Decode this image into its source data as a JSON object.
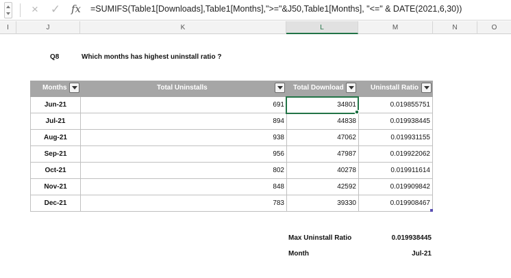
{
  "formula_bar": {
    "cancel_icon": "×",
    "confirm_icon": "✓",
    "fx_label": "fx",
    "formula": "=SUMIFS(Table1[Downloads],Table1[Months],\">=\"&J50,Table1[Months], \"<=\" & DATE(2021,6,30))"
  },
  "columns": [
    "I",
    "J",
    "K",
    "L",
    "M",
    "N",
    "O"
  ],
  "active_column": "L",
  "question": {
    "id": "Q8",
    "text": "Which months has highest uninstall ratio ?"
  },
  "table": {
    "headers": [
      "Months",
      "Total Uninstalls",
      "Total Download",
      "Uninstall Ratio"
    ],
    "rows": [
      {
        "month": "Jun-21",
        "uninstalls": "691",
        "downloads": "34801",
        "ratio": "0.019855751"
      },
      {
        "month": "Jul-21",
        "uninstalls": "894",
        "downloads": "44838",
        "ratio": "0.019938445"
      },
      {
        "month": "Aug-21",
        "uninstalls": "938",
        "downloads": "47062",
        "ratio": "0.019931155"
      },
      {
        "month": "Sep-21",
        "uninstalls": "956",
        "downloads": "47987",
        "ratio": "0.019922062"
      },
      {
        "month": "Oct-21",
        "uninstalls": "802",
        "downloads": "40278",
        "ratio": "0.019911614"
      },
      {
        "month": "Nov-21",
        "uninstalls": "848",
        "downloads": "42592",
        "ratio": "0.019909842"
      },
      {
        "month": "Dec-21",
        "uninstalls": "783",
        "downloads": "39330",
        "ratio": "0.019908467"
      }
    ]
  },
  "summary": {
    "max_label": "Max Uninstall Ratio",
    "max_value": "0.019938445",
    "month_label": "Month",
    "month_value": "Jul-21"
  },
  "colors": {
    "header_fill": "#a6a6a6",
    "selection": "#217346"
  }
}
